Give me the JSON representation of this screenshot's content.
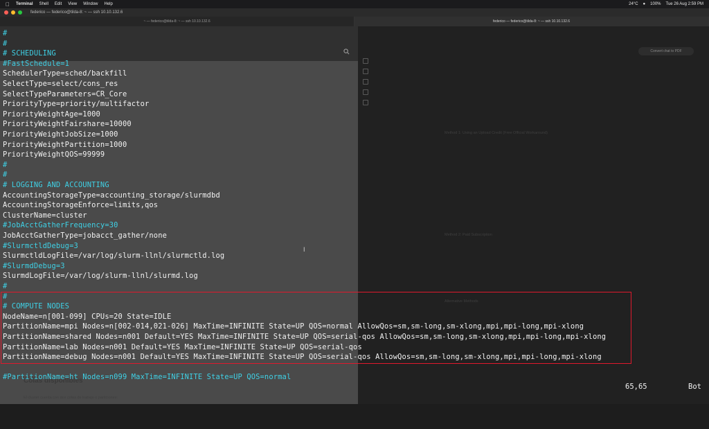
{
  "menubar": {
    "app": "Terminal",
    "items": [
      "Shell",
      "Edit",
      "View",
      "Window",
      "Help"
    ],
    "battery": "100%",
    "temperature": "24°C",
    "datetime": "Tue 26 Aug  2:59 PM"
  },
  "window": {
    "title": "federico — federico@tilda-8: ~ — ssh 10.10.132.6",
    "tabs": [
      "~ — federico@tilda-8: ~ — ssh 10.10.132.6",
      "federico — federico@tilda-8: ~ — ssh 10.10.132.6"
    ]
  },
  "background": {
    "convert_button": "Convert chat to PDF",
    "heading_method1": "Method 1: Using an Upload Credit (Free Official Workaround)",
    "heading_method2": "Method 2: Paid Subscription",
    "heading_alt": "Alternative Methods",
    "colas": "Colas disponibles",
    "colas_sub": "El cluster cuenta con dos colas de trabajo o particiones:"
  },
  "vim": {
    "lines": [
      {
        "text": "#",
        "color": "cyan"
      },
      {
        "text": "#",
        "color": "cyan"
      },
      {
        "text": "# SCHEDULING",
        "color": "cyan"
      },
      {
        "text": "#FastSchedule=1",
        "color": "cyan"
      },
      {
        "text": "SchedulerType=sched/backfill",
        "color": "white"
      },
      {
        "text": "SelectType=select/cons_res",
        "color": "white"
      },
      {
        "text": "SelectTypeParameters=CR_Core",
        "color": "white"
      },
      {
        "text": "PriorityType=priority/multifactor",
        "color": "white"
      },
      {
        "text": "PriorityWeightAge=1000",
        "color": "white"
      },
      {
        "text": "PriorityWeightFairshare=10000",
        "color": "white"
      },
      {
        "text": "PriorityWeightJobSize=1000",
        "color": "white"
      },
      {
        "text": "PriorityWeightPartition=1000",
        "color": "white"
      },
      {
        "text": "PriorityWeightQOS=99999",
        "color": "white"
      },
      {
        "text": "#",
        "color": "cyan"
      },
      {
        "text": "#",
        "color": "cyan"
      },
      {
        "text": "# LOGGING AND ACCOUNTING",
        "color": "cyan"
      },
      {
        "text": "AccountingStorageType=accounting_storage/slurmdbd",
        "color": "white"
      },
      {
        "text": "AccountingStorageEnforce=limits,qos",
        "color": "white"
      },
      {
        "text": "ClusterName=cluster",
        "color": "white"
      },
      {
        "text": "#JobAcctGatherFrequency=30",
        "color": "cyan"
      },
      {
        "text": "JobAcctGatherType=jobacct_gather/none",
        "color": "white"
      },
      {
        "text": "#SlurmctldDebug=3",
        "color": "cyan"
      },
      {
        "text": "SlurmctldLogFile=/var/log/slurm-llnl/slurmctld.log",
        "color": "white"
      },
      {
        "text": "#SlurmdDebug=3",
        "color": "cyan"
      },
      {
        "text": "SlurmdLogFile=/var/log/slurm-llnl/slurmd.log",
        "color": "white"
      },
      {
        "text": "#",
        "color": "cyan"
      },
      {
        "text": "#",
        "color": "cyan"
      },
      {
        "text": "# COMPUTE NODES",
        "color": "cyan"
      },
      {
        "text": "NodeName=n[001-099] CPUs=20 State=IDLE",
        "color": "white"
      },
      {
        "text": "PartitionName=mpi Nodes=n[002-014,021-026] MaxTime=INFINITE State=UP QOS=normal AllowQos=sm,sm-long,sm-xlong,mpi,mpi-long,mpi-xlong",
        "color": "white"
      },
      {
        "text": "PartitionName=shared Nodes=n001 Default=YES MaxTime=INFINITE State=UP QOS=serial-qos AllowQos=sm,sm-long,sm-xlong,mpi,mpi-long,mpi-xlong",
        "color": "white"
      },
      {
        "text": "PartitionName=lab Nodes=n001 Default=YES MaxTime=INFINITE State=UP QOS=serial-qos",
        "color": "white"
      },
      {
        "text": "PartitionName=debug Nodes=n001 Default=YES MaxTime=INFINITE State=UP QOS=serial-qos AllowQos=sm,sm-long,sm-xlong,mpi,mpi-long,mpi-xlong",
        "color": "white"
      },
      {
        "text": "",
        "color": "white"
      },
      {
        "text": "#PartitionName=ht Nodes=n099 MaxTime=INFINITE State=UP QOS=normal",
        "color": "cyan"
      }
    ],
    "status_position": "65,65",
    "status_scroll": "Bot"
  },
  "colors": {
    "comment": "#3fd1e6",
    "text": "#f2f2f2",
    "highlight_box": "#e0192d"
  }
}
